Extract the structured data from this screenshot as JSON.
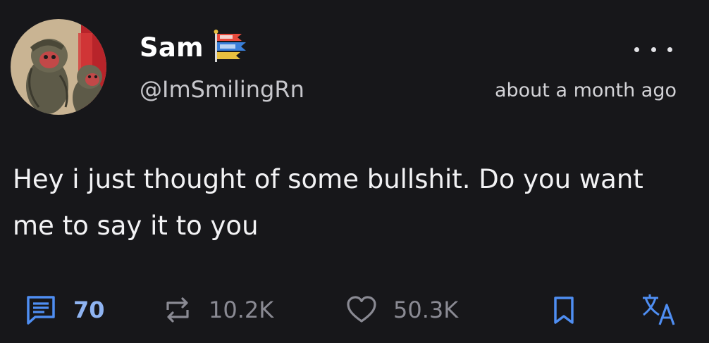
{
  "author": {
    "display_name": "Sam",
    "handle": "@ImSmilingRn",
    "avatar_icon": "avatar-monkeys-image",
    "name_emoji": "carp-streamer-flag-emoji"
  },
  "post": {
    "timestamp": "about a month ago",
    "text": "Hey i just thought of some bullshit. Do you want me to say it to you"
  },
  "actions": {
    "comments": {
      "icon": "comment-icon",
      "count": "70"
    },
    "reposts": {
      "icon": "repost-icon",
      "count": "10.2K"
    },
    "likes": {
      "icon": "heart-icon",
      "count": "50.3K"
    },
    "bookmark": {
      "icon": "bookmark-icon"
    },
    "translate": {
      "icon": "translate-icon"
    },
    "more": {
      "icon": "more-options-icon"
    }
  },
  "colors": {
    "background": "#17171a",
    "accent": "#4f8ef2",
    "muted": "#8a8a93"
  }
}
